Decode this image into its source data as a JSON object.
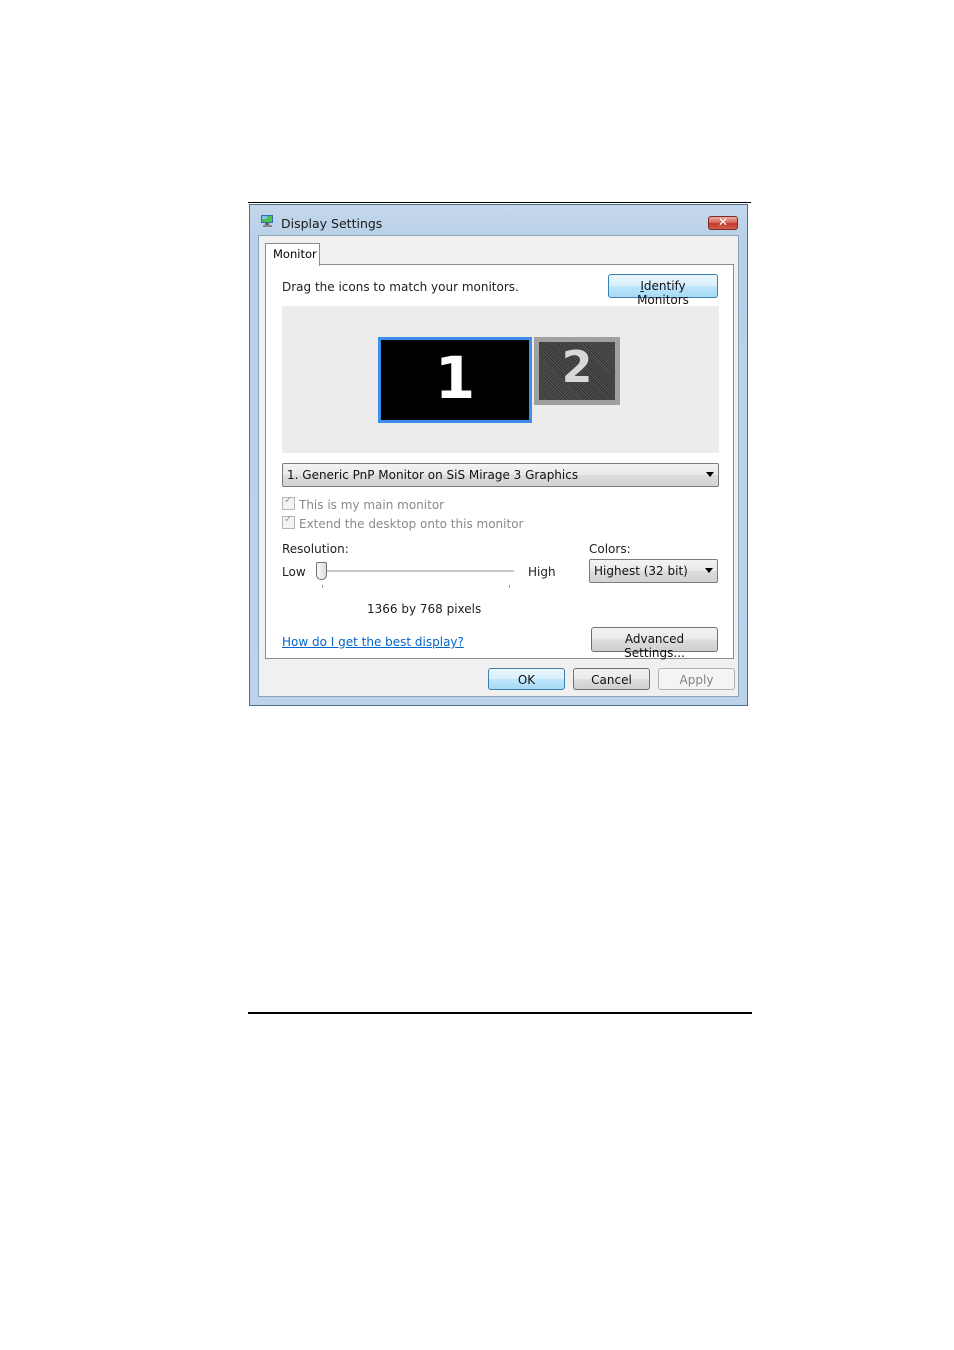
{
  "window": {
    "title": "Display Settings",
    "app_icon": "display-settings-icon",
    "close_icon": "close-icon"
  },
  "tabs": [
    {
      "label": "Monitor",
      "selected": true
    }
  ],
  "monitor_tab": {
    "instruction": "Drag the icons to match your monitors.",
    "identify_button": {
      "label": "Identify Monitors",
      "accesskey": "I"
    },
    "monitors": [
      {
        "number": "1",
        "selected": true
      },
      {
        "number": "2",
        "selected": false
      }
    ],
    "monitor_select": {
      "value": "1. Generic PnP Monitor on SiS Mirage 3 Graphics"
    },
    "checkboxes": [
      {
        "label": "This is my main monitor",
        "checked": true,
        "enabled": false
      },
      {
        "label": "Extend the desktop onto this monitor",
        "checked": true,
        "enabled": false
      }
    ],
    "resolution": {
      "label": "Resolution:",
      "low_label": "Low",
      "high_label": "High",
      "value_text": "1366 by 768 pixels",
      "slider_position": 0
    },
    "colors": {
      "label": "Colors:",
      "value": "Highest (32 bit)"
    },
    "help_link": "How do I get the best display?",
    "advanced_button": "Advanced Settings..."
  },
  "footer": {
    "ok": "OK",
    "cancel": "Cancel",
    "apply": "Apply"
  },
  "colors_theme": {
    "selected_monitor_border": "#3b8fe8",
    "link": "#0066cc",
    "close_button": "#c0392b"
  }
}
